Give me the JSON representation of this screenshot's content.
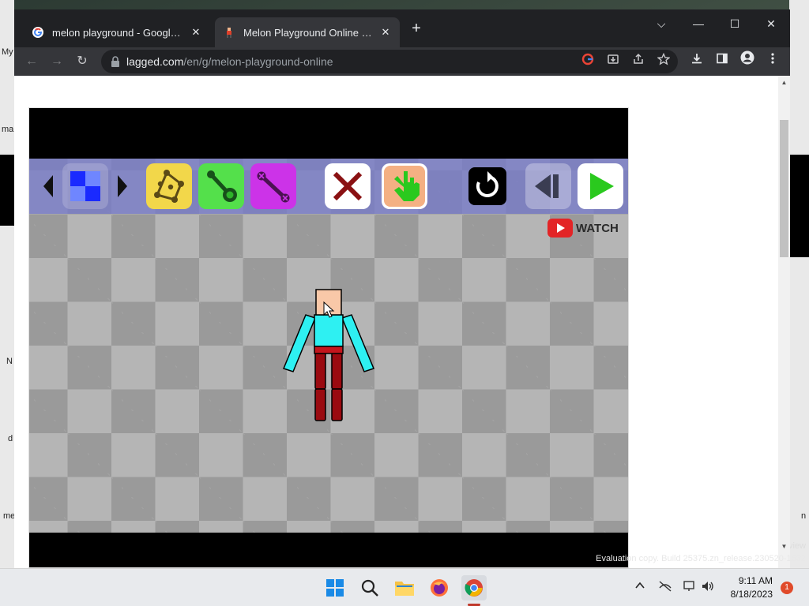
{
  "desktop": {
    "left_labels": [
      "My",
      "ma",
      "N",
      "d",
      "me"
    ],
    "right_labels": [
      "n",
      "view"
    ],
    "watermark": "Evaluation copy. Build 25375.zn_release.230520-1632"
  },
  "browser": {
    "tabs": [
      {
        "title": "melon playground - Google Search",
        "favicon": "google-icon",
        "close": "✕"
      },
      {
        "title": "Melon Playground Online - Play Free Online",
        "favicon": "game-favicon",
        "close": "✕"
      }
    ],
    "new_tab": "+",
    "window_controls": {
      "dropdown": "⌵",
      "minimize": "—",
      "maximize": "☐",
      "close": "✕"
    },
    "toolbar": {
      "back": "←",
      "forward": "→",
      "reload": "↻",
      "url_host": "lagged.com",
      "url_path": "/en/g/melon-playground-online"
    }
  },
  "game": {
    "watch_label": "WATCH",
    "buttons": [
      "prev-palette-arrow",
      "blue-block-palette",
      "next-palette-arrow",
      "polygon-tool",
      "rigid-joint-tool",
      "spring-joint-tool",
      "delete-tool",
      "drag-hand-tool",
      "reset-button",
      "step-back-button",
      "play-button"
    ],
    "colors": {
      "yellow_tool": "#f2d74a",
      "green_tool": "#54e04b",
      "purple_tool": "#cc33e8",
      "head": "#f9c8a8",
      "torso": "#2ef0f2",
      "legs": "#9a0a10",
      "toolbar_bg": "#767ac8"
    }
  },
  "taskbar": {
    "time": "9:11 AM",
    "date": "8/18/2023",
    "notification_count": "1"
  }
}
